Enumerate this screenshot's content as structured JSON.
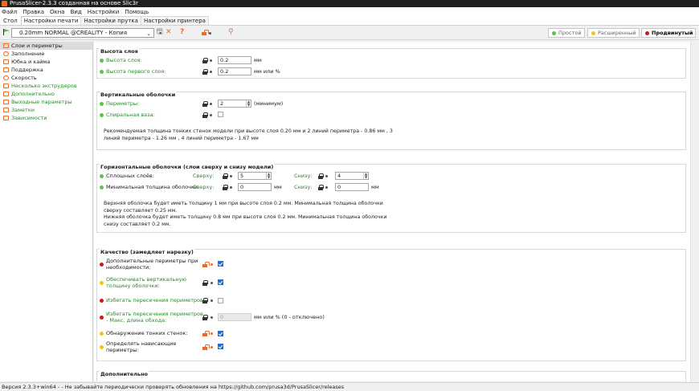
{
  "window": {
    "title": "PrusaSlicer-2.3.3 созданная на основе Slic3r"
  },
  "menu": [
    "Файл",
    "Правка",
    "Окна",
    "Вид",
    "Настройки",
    "Помощь"
  ],
  "tabs": [
    "Стол",
    "Настройки печати",
    "Настройки прутка",
    "Настройки принтера"
  ],
  "toolbar": {
    "preset": "0.20mm NORMAL @CREALITY - Копия",
    "modes": [
      {
        "label": "Простой",
        "color": "#5ac34a"
      },
      {
        "label": "Расширенный",
        "color": "#f0c419"
      },
      {
        "label": "Продвинутый",
        "color": "#d01616"
      }
    ]
  },
  "sidebar": [
    {
      "label": "Слои и периметры",
      "selected": true,
      "green": false
    },
    {
      "label": "Заполнение",
      "selected": false,
      "green": false
    },
    {
      "label": "Юбка и кайма",
      "selected": false,
      "green": false
    },
    {
      "label": "Поддержка",
      "selected": false,
      "green": false
    },
    {
      "label": "Скорость",
      "selected": false,
      "green": false
    },
    {
      "label": "Несколько экструдеров",
      "selected": false,
      "green": true
    },
    {
      "label": "Дополнительно",
      "selected": false,
      "green": true
    },
    {
      "label": "Выходные параметры",
      "selected": false,
      "green": true
    },
    {
      "label": "Заметки",
      "selected": false,
      "green": true
    },
    {
      "label": "Зависимости",
      "selected": false,
      "green": true
    }
  ],
  "layer_height": {
    "title": "Высота слоя",
    "layer_label": "Высота слоя:",
    "layer_value": "0.2",
    "layer_unit": "мм",
    "first_label": "Высота первого слоя:",
    "first_value": "0.2",
    "first_unit": "мм или %"
  },
  "vertical_shells": {
    "title": "Вертикальные оболочки",
    "perimeters_label": "Периметры:",
    "perimeters_value": "2",
    "perimeters_unit": "(минимум)",
    "spiral_label": "Спиральная ваза:",
    "note": "Рекомендуемая толщина тонких стенок модели при высоте слоя 0.20 мм и 2 линий периметра - 0.86 мм , 3\nлиний периметра - 1.26 мм , 4 линий периметра - 1.67 мм"
  },
  "horizontal_shells": {
    "title": "Горизонтальные оболочки (слои сверху и снизу модели)",
    "solid_label": "Сплошных слоёв:",
    "min_label": "Минимальная толщина оболочки:",
    "top_label": "Сверху:",
    "bottom_label": "Снизу:",
    "solid_top": "5",
    "solid_bottom": "4",
    "min_top": "0",
    "min_bottom": "0",
    "unit": "мм",
    "note": "Верхняя оболочка будет иметь толщину 1 мм при высоте слоя 0.2 мм. Минимальная толщина оболочки\nсверху составляет 0.25 мм.\nНижняя оболочка будет иметь толщину 0.8 мм при высоте слоя 0.2 мм. Минимальная толщина оболочки\nснизу составляет 0.2 мм."
  },
  "quality": {
    "title": "Качество (замедляет нарезку)",
    "extra_perimeters": "Дополнительные периметры при\nнеобходимости:",
    "ensure_vertical": "Обеспечивать вертикальную\nтолщину оболочки:",
    "avoid_crossing": "Избегать пересечения периметров:",
    "avoid_max": "Избегать пересечения периметров\n- Макс. длина обхода:",
    "avoid_max_value": "0",
    "avoid_max_unit": "мм или % (0 - отключено)",
    "thin_walls": "Обнаружение тонких стенок:",
    "overhangs": "Определять нависающие\nпериметры:"
  },
  "advanced": {
    "title": "Дополнительно"
  },
  "status": "Версия 2.3.3+win64 - - Не забывайте периодически проверять обновления на https://github.com/prusa3d/PrusaSlicer/releases"
}
